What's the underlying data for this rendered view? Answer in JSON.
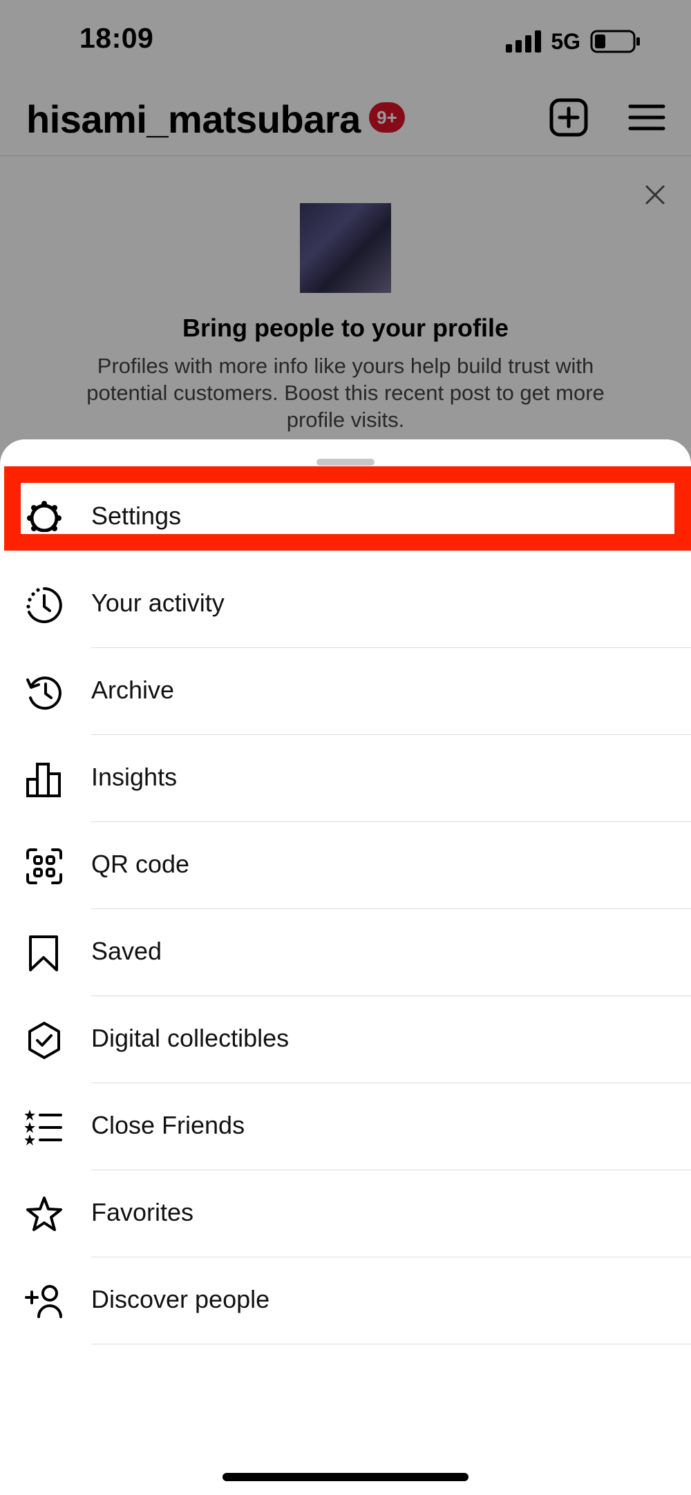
{
  "status_bar": {
    "time": "18:09",
    "network": "5G"
  },
  "profile": {
    "username": "hisami_matsubara",
    "notification_badge": "9+"
  },
  "promo": {
    "title": "Bring people to your profile",
    "body": "Profiles with more info like yours help build trust with potential customers. Boost this recent post to get more profile visits."
  },
  "menu": {
    "items": [
      {
        "label": "Settings",
        "icon": "gear-icon"
      },
      {
        "label": "Your activity",
        "icon": "activity-icon"
      },
      {
        "label": "Archive",
        "icon": "archive-history-icon"
      },
      {
        "label": "Insights",
        "icon": "bar-chart-icon"
      },
      {
        "label": "QR code",
        "icon": "qr-code-icon"
      },
      {
        "label": "Saved",
        "icon": "bookmark-icon"
      },
      {
        "label": "Digital collectibles",
        "icon": "shield-check-icon"
      },
      {
        "label": "Close Friends",
        "icon": "star-list-icon"
      },
      {
        "label": "Favorites",
        "icon": "star-icon"
      },
      {
        "label": "Discover people",
        "icon": "add-person-icon"
      }
    ]
  },
  "colors": {
    "highlight": "#ff2200",
    "badge": "#e0132b"
  }
}
